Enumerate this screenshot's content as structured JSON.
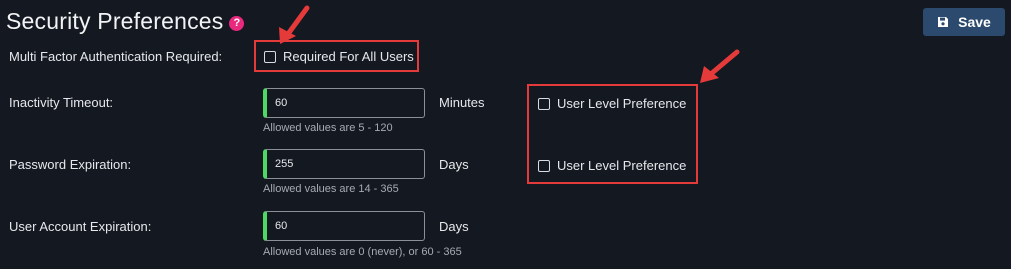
{
  "header": {
    "title": "Security Preferences",
    "help_icon": "question-circle-icon",
    "save_label": "Save",
    "save_icon": "floppy-disk-icon"
  },
  "mfa": {
    "label": "Multi Factor Authentication Required:",
    "checkbox_label": "Required For All Users",
    "checked": false
  },
  "fields": [
    {
      "label": "Inactivity Timeout:",
      "value": "60",
      "unit": "Minutes",
      "hint": "Allowed values are 5 - 120",
      "user_pref_label": "User Level Preference",
      "user_pref_checked": false
    },
    {
      "label": "Password Expiration:",
      "value": "255",
      "unit": "Days",
      "hint": "Allowed values are 14 - 365",
      "user_pref_label": "User Level Preference",
      "user_pref_checked": false
    },
    {
      "label": "User Account Expiration:",
      "value": "60",
      "unit": "Days",
      "hint": "Allowed values are 0 (never), or 60 - 365"
    }
  ],
  "colors": {
    "background": "#141820",
    "save_button": "#2b4a6d",
    "input_accent": "#4cd964",
    "highlight": "#e53a3a",
    "help_icon": "#e8297d"
  }
}
